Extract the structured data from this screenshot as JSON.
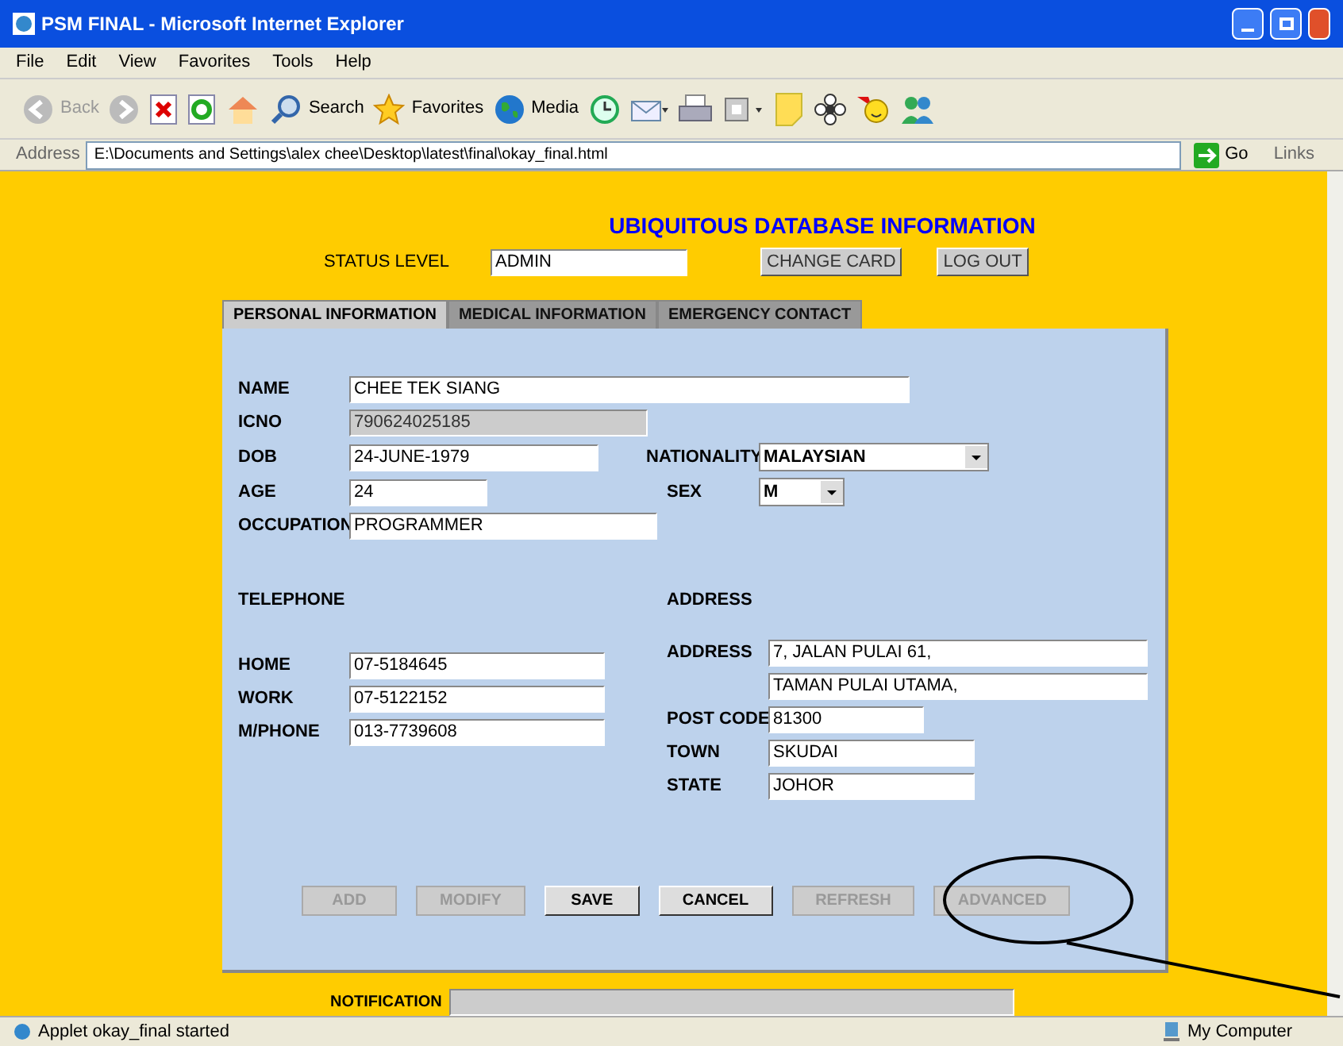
{
  "window": {
    "title": "PSM FINAL - Microsoft Internet Explorer"
  },
  "menu": [
    "File",
    "Edit",
    "View",
    "Favorites",
    "Tools",
    "Help"
  ],
  "toolbar": [
    {
      "kind": "back",
      "label": "Back"
    },
    {
      "kind": "forward"
    },
    {
      "kind": "stop"
    },
    {
      "kind": "refresh"
    },
    {
      "kind": "home"
    },
    {
      "kind": "search",
      "label": "Search"
    },
    {
      "kind": "favorites",
      "label": "Favorites"
    },
    {
      "kind": "media",
      "label": "Media"
    },
    {
      "kind": "history"
    },
    {
      "kind": "mail"
    },
    {
      "kind": "print"
    },
    {
      "kind": "edit"
    },
    {
      "kind": "note"
    },
    {
      "kind": "flower"
    },
    {
      "kind": "messenger"
    },
    {
      "kind": "people"
    }
  ],
  "address_bar": {
    "label": "Address",
    "value": "E:\\Documents and Settings\\alex chee\\Desktop\\latest\\final\\okay_final.html",
    "go": "Go",
    "links": "Links"
  },
  "page": {
    "title": "UBIQUITOUS DATABASE INFORMATION",
    "status_label": "STATUS LEVEL",
    "status_value": "ADMIN",
    "header_buttons": [
      "CHANGE CARD",
      "LOG OUT"
    ]
  },
  "tabs": [
    {
      "label": "PERSONAL INFORMATION",
      "selected": true
    },
    {
      "label": "MEDICAL INFORMATION",
      "selected": false
    },
    {
      "label": "EMERGENCY CONTACT",
      "selected": false
    }
  ],
  "personal": [
    {
      "label": "NAME",
      "value": "CHEE TEK SIANG",
      "kind": "text"
    },
    {
      "label": "ICNO",
      "value": "790624025185",
      "kind": "text",
      "disabled": true
    },
    {
      "label": "DOB",
      "value": "24-JUNE-1979",
      "kind": "text"
    },
    {
      "label": "NATIONALITY",
      "value": "MALAYSIAN",
      "kind": "select"
    },
    {
      "label": "AGE",
      "value": "24",
      "kind": "text"
    },
    {
      "label": "SEX",
      "value": "M",
      "kind": "select"
    },
    {
      "label": "OCCUPATION",
      "value": "PROGRAMMER",
      "kind": "text"
    }
  ],
  "telephone": {
    "heading": "TELEPHONE",
    "fields": [
      {
        "label": "HOME",
        "value": "07-5184645"
      },
      {
        "label": "WORK",
        "value": "07-5122152"
      },
      {
        "label": "M/PHONE",
        "value": "013-7739608"
      }
    ]
  },
  "address": {
    "heading": "ADDRESS",
    "fields": [
      {
        "label": "ADDRESS",
        "value": "7, JALAN PULAI 61,"
      },
      {
        "value": "TAMAN PULAI UTAMA,"
      },
      {
        "label": "POST CODE",
        "value": "81300"
      },
      {
        "label": "TOWN",
        "value": "SKUDAI"
      },
      {
        "label": "STATE",
        "value": "JOHOR"
      }
    ]
  },
  "actions": [
    {
      "label": "ADD",
      "disabled": true
    },
    {
      "label": "MODIFY",
      "disabled": true
    },
    {
      "label": "SAVE",
      "disabled": false
    },
    {
      "label": "CANCEL",
      "disabled": false
    },
    {
      "label": "REFRESH",
      "disabled": true
    },
    {
      "label": "ADVANCED",
      "disabled": true
    }
  ],
  "notification": {
    "label": "NOTIFICATION"
  },
  "status_bar": {
    "text": "Applet okay_final started",
    "zone": "My Computer"
  }
}
